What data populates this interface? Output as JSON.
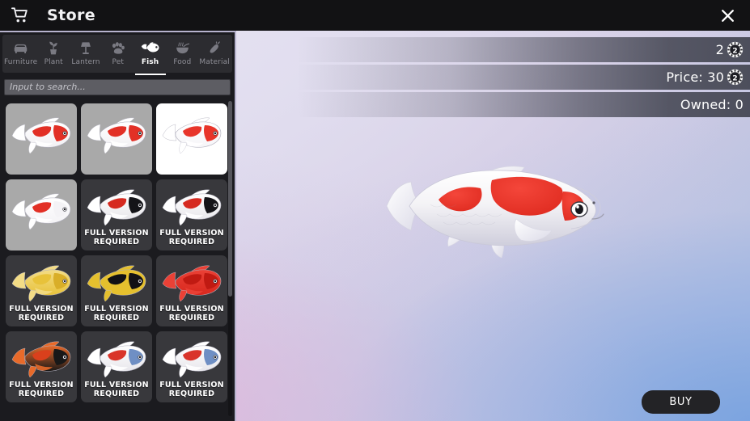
{
  "window": {
    "title": "Store",
    "cart_icon": "shopping-cart-icon",
    "close_icon": "close-icon"
  },
  "tabs": [
    {
      "label": "Furniture",
      "icon": "sofa-icon",
      "active": false
    },
    {
      "label": "Plant",
      "icon": "plant-icon",
      "active": false
    },
    {
      "label": "Lantern",
      "icon": "lamp-icon",
      "active": false
    },
    {
      "label": "Pet",
      "icon": "paw-icon",
      "active": false
    },
    {
      "label": "Fish",
      "icon": "fish-icon",
      "active": true
    },
    {
      "label": "Food",
      "icon": "bowl-icon",
      "active": false
    },
    {
      "label": "Material",
      "icon": "carrot-icon",
      "active": false
    }
  ],
  "search": {
    "placeholder": "Input to search...",
    "value": ""
  },
  "grid": {
    "lock_label_line1": "FULL VERSION",
    "lock_label_line2": "REQUIRED",
    "items": [
      {
        "name": "koi-red-white-1",
        "locked": false,
        "selected": false,
        "bg": "#a9a9a9"
      },
      {
        "name": "koi-red-white-2",
        "locked": false,
        "selected": false,
        "bg": "#a9a9a9"
      },
      {
        "name": "koi-red-white-3",
        "locked": false,
        "selected": true,
        "bg": "#ffffff"
      },
      {
        "name": "koi-white-platinum",
        "locked": false,
        "selected": false,
        "bg": "#a9a9a9"
      },
      {
        "name": "koi-showa-1",
        "locked": true,
        "selected": false,
        "bg": "#38383c"
      },
      {
        "name": "koi-showa-2",
        "locked": true,
        "selected": false,
        "bg": "#38383c"
      },
      {
        "name": "koi-yamabuki-gold",
        "locked": true,
        "selected": false,
        "bg": "#38383c"
      },
      {
        "name": "koi-yellow-black",
        "locked": true,
        "selected": false,
        "bg": "#38383c"
      },
      {
        "name": "koi-red-benigoi",
        "locked": true,
        "selected": false,
        "bg": "#38383c"
      },
      {
        "name": "koi-orange-black",
        "locked": true,
        "selected": false,
        "bg": "#38383c"
      },
      {
        "name": "koi-blue-asagi-1",
        "locked": true,
        "selected": false,
        "bg": "#38383c"
      },
      {
        "name": "koi-blue-asagi-2",
        "locked": true,
        "selected": false,
        "bg": "#38383c"
      }
    ]
  },
  "info": {
    "balance_value": "2",
    "balance_coin_icon": "coin-icon",
    "price_text": "Price: 30",
    "price_coin_icon": "coin-icon",
    "owned_text": "Owned: 0"
  },
  "preview": {
    "item": "koi-red-white-3"
  },
  "actions": {
    "buy_label": "BUY"
  },
  "colors": {
    "panel_bg": "#1b1b1f",
    "tabbar_bg": "#2c2c30",
    "titlebar_bg": "#121214",
    "cell_locked_bg": "#38383c",
    "cell_unlocked_bg": "#a9a9a9",
    "cell_selected_bg": "#ffffff",
    "accent_text": "#ffffff",
    "koi_red": "#e8342a",
    "buy_bg": "#232326",
    "panel_border": "#b7b3cd"
  }
}
